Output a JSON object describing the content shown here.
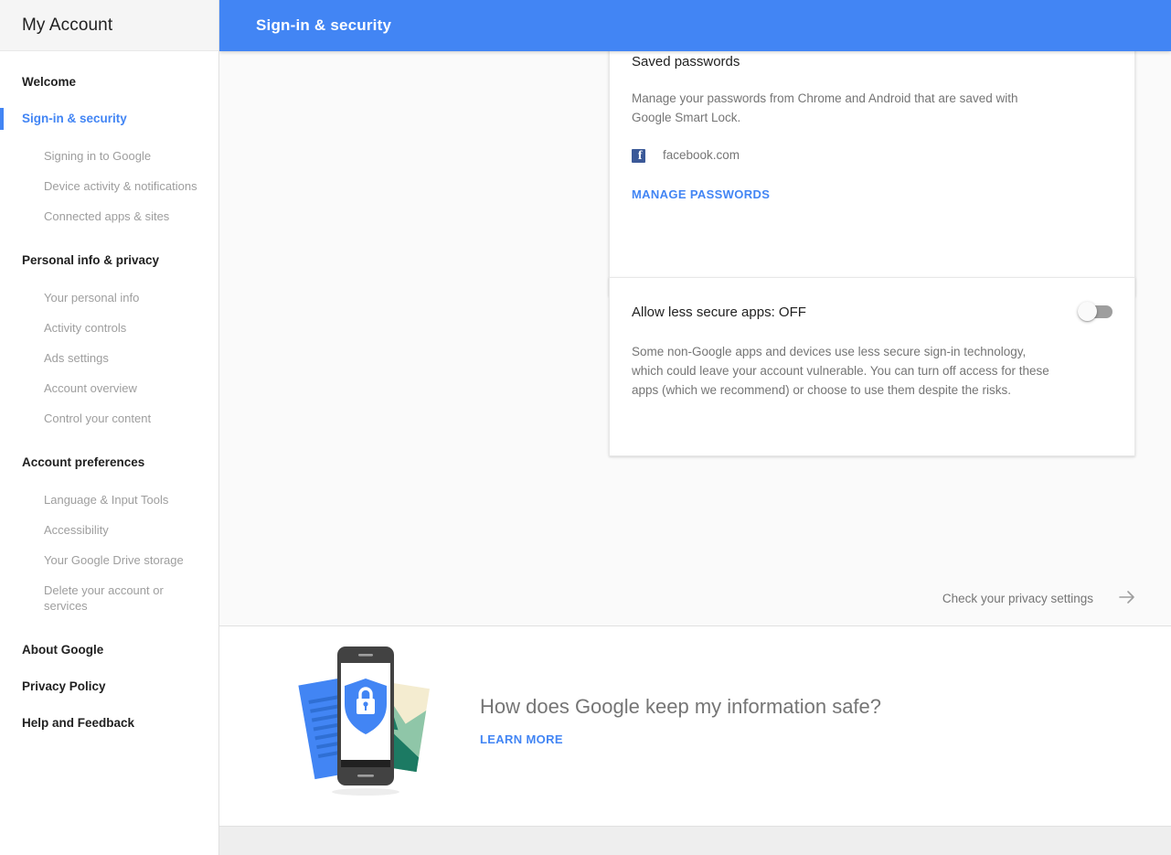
{
  "sidebar": {
    "brand": "My Account",
    "nav": [
      {
        "label": "Welcome",
        "type": "top",
        "active": false
      },
      {
        "label": "Sign-in & security",
        "type": "top",
        "active": true
      },
      {
        "label": "Signing in to Google",
        "type": "sub",
        "active": false
      },
      {
        "label": "Device activity & notifications",
        "type": "sub",
        "active": false
      },
      {
        "label": "Connected apps & sites",
        "type": "sub",
        "active": false
      },
      {
        "label": "Personal info & privacy",
        "type": "section",
        "active": false
      },
      {
        "label": "Your personal info",
        "type": "sub",
        "active": false
      },
      {
        "label": "Activity controls",
        "type": "sub",
        "active": false
      },
      {
        "label": "Ads settings",
        "type": "sub",
        "active": false
      },
      {
        "label": "Account overview",
        "type": "sub",
        "active": false
      },
      {
        "label": "Control your content",
        "type": "sub",
        "active": false
      },
      {
        "label": "Account preferences",
        "type": "section",
        "active": false
      },
      {
        "label": "Language & Input Tools",
        "type": "sub",
        "active": false
      },
      {
        "label": "Accessibility",
        "type": "sub",
        "active": false
      },
      {
        "label": "Your Google Drive storage",
        "type": "sub",
        "active": false
      },
      {
        "label": "Delete your account or services",
        "type": "sub",
        "active": false
      },
      {
        "label": "About Google",
        "type": "top",
        "active": false
      },
      {
        "label": "Privacy Policy",
        "type": "top",
        "active": false
      },
      {
        "label": "Help and Feedback",
        "type": "top",
        "active": false
      }
    ]
  },
  "header": {
    "title": "Sign-in & security",
    "background_color": "#4285f4"
  },
  "cards": {
    "saved_passwords": {
      "title": "Saved passwords",
      "description": "Manage your passwords from Chrome and Android that are saved with Google Smart Lock.",
      "sites": [
        {
          "name": "facebook.com",
          "icon": "facebook-icon",
          "icon_color": "#3b5998"
        }
      ],
      "action_label": "MANAGE PASSWORDS"
    },
    "less_secure_apps": {
      "title": "Allow less secure apps: OFF",
      "toggle_state": "off",
      "description": "Some non-Google apps and devices use less secure sign-in technology, which could leave your account vulnerable. You can turn off access for these apps (which we recommend) or choose to use them despite the risks."
    }
  },
  "privacy_check": {
    "label": "Check your privacy settings",
    "icon": "arrow-right-icon"
  },
  "promo": {
    "title": "How does Google keep my information safe?",
    "link_label": "LEARN MORE",
    "illustration": "phone-shield-lock-illustration"
  },
  "colors": {
    "accent": "#4285f4",
    "page_background": "#fafafa",
    "card_background": "#ffffff",
    "muted_text": "#757575",
    "strip": "#eeeeee"
  }
}
